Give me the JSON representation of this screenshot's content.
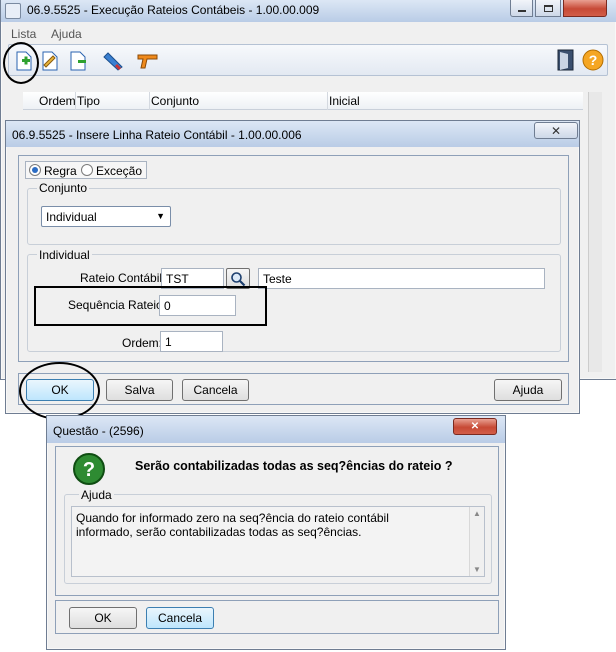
{
  "main_window": {
    "title": "06.9.5525 - Execução Rateios Contábeis - 1.00.00.009",
    "menu": [
      "Lista",
      "Ajuda"
    ],
    "toolbar_icons": [
      "new-doc-icon",
      "edit-doc-icon",
      "copy-doc-icon",
      "erase-icon",
      "gun-icon"
    ],
    "right_icons": [
      "exit-door-icon",
      "help-icon"
    ],
    "grid_columns": [
      "Ordem",
      "Tipo",
      "Conjunto",
      "Inicial"
    ]
  },
  "insert_dialog": {
    "title": "06.9.5525 - Insere Linha Rateio Contábil - 1.00.00.006",
    "radio_regra": "Regra",
    "radio_excecao": "Exceção",
    "conjunto_label": "Conjunto",
    "conjunto_value": "Individual",
    "individual_label": "Individual",
    "rateio_label": "Rateio Contábil:",
    "rateio_code": "TST",
    "rateio_desc": "Teste",
    "sequencia_label": "Sequência Rateio:",
    "sequencia_value": "0",
    "ordem_label": "Ordem:",
    "ordem_value": "1",
    "ok_label": "OK",
    "salva_label": "Salva",
    "cancela_label": "Cancela",
    "ajuda_label": "Ajuda"
  },
  "question_dialog": {
    "title": "Questão - (2596)",
    "question": "Serão contabilizadas todas as seq?ências do rateio ?",
    "help_label": "Ajuda",
    "help_line1": "Quando for informado zero na seq?ência do rateio contábil",
    "help_line2": "informado, serão contabilizadas todas as seq?ências.",
    "ok_label": "OK",
    "cancel_label": "Cancela"
  },
  "colors": {
    "titlebar": "#c4d4ea",
    "accent": "#3c7fb1",
    "help_green": "#2e8b32"
  }
}
